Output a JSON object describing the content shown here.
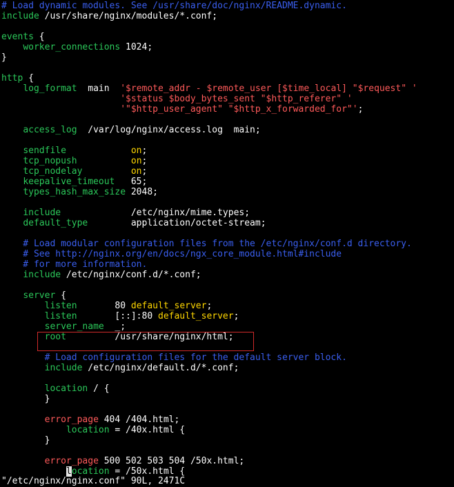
{
  "colors": {
    "background": "#000000",
    "text": "#ffffff",
    "comment": "#3a5ff0",
    "keyword": "#2bc85a",
    "string": "#ff5a5a",
    "value": "#ffd700",
    "highlight_box": "#d12a2a"
  },
  "lines": [
    [
      {
        "t": "# Load dynamic modules. See /usr/share/doc/nginx/README.dynamic.",
        "c": "comment"
      }
    ],
    [
      {
        "t": "include",
        "c": "keyword"
      },
      {
        "t": " /usr/share/nginx/modules/*.conf;",
        "c": "text"
      }
    ],
    [],
    [
      {
        "t": "events",
        "c": "keyword"
      },
      {
        "t": " {",
        "c": "text"
      }
    ],
    [
      {
        "t": "    ",
        "c": "text"
      },
      {
        "t": "worker_connections",
        "c": "keyword"
      },
      {
        "t": " 1024;",
        "c": "text"
      }
    ],
    [
      {
        "t": "}",
        "c": "text"
      }
    ],
    [],
    [
      {
        "t": "http",
        "c": "keyword"
      },
      {
        "t": " {",
        "c": "text"
      }
    ],
    [
      {
        "t": "    ",
        "c": "text"
      },
      {
        "t": "log_format",
        "c": "keyword"
      },
      {
        "t": "  main  ",
        "c": "text"
      },
      {
        "t": "'$remote_addr - $remote_user [$time_local] \"$request\" '",
        "c": "string"
      }
    ],
    [
      {
        "t": "                      ",
        "c": "text"
      },
      {
        "t": "'$status $body_bytes_sent \"$http_referer\" '",
        "c": "string"
      }
    ],
    [
      {
        "t": "                      ",
        "c": "text"
      },
      {
        "t": "'\"$http_user_agent\" \"$http_x_forwarded_for\"'",
        "c": "string"
      },
      {
        "t": ";",
        "c": "text"
      }
    ],
    [],
    [
      {
        "t": "    ",
        "c": "text"
      },
      {
        "t": "access_log",
        "c": "keyword"
      },
      {
        "t": "  /var/log/nginx/access.log  main;",
        "c": "text"
      }
    ],
    [],
    [
      {
        "t": "    ",
        "c": "text"
      },
      {
        "t": "sendfile",
        "c": "keyword"
      },
      {
        "t": "            ",
        "c": "text"
      },
      {
        "t": "on",
        "c": "value"
      },
      {
        "t": ";",
        "c": "text"
      }
    ],
    [
      {
        "t": "    ",
        "c": "text"
      },
      {
        "t": "tcp_nopush",
        "c": "keyword"
      },
      {
        "t": "          ",
        "c": "text"
      },
      {
        "t": "on",
        "c": "value"
      },
      {
        "t": ";",
        "c": "text"
      }
    ],
    [
      {
        "t": "    ",
        "c": "text"
      },
      {
        "t": "tcp_nodelay",
        "c": "keyword"
      },
      {
        "t": "         ",
        "c": "text"
      },
      {
        "t": "on",
        "c": "value"
      },
      {
        "t": ";",
        "c": "text"
      }
    ],
    [
      {
        "t": "    ",
        "c": "text"
      },
      {
        "t": "keepalive_timeout",
        "c": "keyword"
      },
      {
        "t": "   65;",
        "c": "text"
      }
    ],
    [
      {
        "t": "    ",
        "c": "text"
      },
      {
        "t": "types_hash_max_size",
        "c": "keyword"
      },
      {
        "t": " 2048;",
        "c": "text"
      }
    ],
    [],
    [
      {
        "t": "    ",
        "c": "text"
      },
      {
        "t": "include",
        "c": "keyword"
      },
      {
        "t": "             /etc/nginx/mime.types;",
        "c": "text"
      }
    ],
    [
      {
        "t": "    ",
        "c": "text"
      },
      {
        "t": "default_type",
        "c": "keyword"
      },
      {
        "t": "        application/octet-stream;",
        "c": "text"
      }
    ],
    [],
    [
      {
        "t": "    # Load modular configuration files from the /etc/nginx/conf.d directory.",
        "c": "comment"
      }
    ],
    [
      {
        "t": "    # See http://nginx.org/en/docs/ngx_core_module.html#include",
        "c": "comment"
      }
    ],
    [
      {
        "t": "    # for more information.",
        "c": "comment"
      }
    ],
    [
      {
        "t": "    ",
        "c": "text"
      },
      {
        "t": "include",
        "c": "keyword"
      },
      {
        "t": " /etc/nginx/conf.d/*.conf;",
        "c": "text"
      }
    ],
    [],
    [
      {
        "t": "    ",
        "c": "text"
      },
      {
        "t": "server",
        "c": "keyword"
      },
      {
        "t": " {",
        "c": "text"
      }
    ],
    [
      {
        "t": "        ",
        "c": "text"
      },
      {
        "t": "listen",
        "c": "keyword"
      },
      {
        "t": "       80 ",
        "c": "text"
      },
      {
        "t": "default_server",
        "c": "value"
      },
      {
        "t": ";",
        "c": "text"
      }
    ],
    [
      {
        "t": "        ",
        "c": "text"
      },
      {
        "t": "listen",
        "c": "keyword"
      },
      {
        "t": "       [::]:80 ",
        "c": "text"
      },
      {
        "t": "default_server",
        "c": "value"
      },
      {
        "t": ";",
        "c": "text"
      }
    ],
    [
      {
        "t": "        ",
        "c": "text"
      },
      {
        "t": "server_name",
        "c": "keyword"
      },
      {
        "t": "  _;",
        "c": "text"
      }
    ],
    [
      {
        "t": "        ",
        "c": "text"
      },
      {
        "t": "root",
        "c": "keyword"
      },
      {
        "t": "         /usr/share/nginx/html;",
        "c": "text"
      }
    ],
    [],
    [
      {
        "t": "        # Load configuration files for the default server block.",
        "c": "comment"
      }
    ],
    [
      {
        "t": "        ",
        "c": "text"
      },
      {
        "t": "include",
        "c": "keyword"
      },
      {
        "t": " /etc/nginx/default.d/*.conf;",
        "c": "text"
      }
    ],
    [],
    [
      {
        "t": "        ",
        "c": "text"
      },
      {
        "t": "location",
        "c": "keyword"
      },
      {
        "t": " / {",
        "c": "text"
      }
    ],
    [
      {
        "t": "        }",
        "c": "text"
      }
    ],
    [],
    [
      {
        "t": "        ",
        "c": "text"
      },
      {
        "t": "error_page",
        "c": "string"
      },
      {
        "t": " 404 /404.html;",
        "c": "text"
      }
    ],
    [
      {
        "t": "            ",
        "c": "text"
      },
      {
        "t": "location",
        "c": "keyword"
      },
      {
        "t": " = /40x.html {",
        "c": "text"
      }
    ],
    [
      {
        "t": "        }",
        "c": "text"
      }
    ],
    [],
    [
      {
        "t": "        ",
        "c": "text"
      },
      {
        "t": "error_page",
        "c": "string"
      },
      {
        "t": " 500 502 503 504 /50x.html;",
        "c": "text"
      }
    ],
    [
      {
        "t": "            ",
        "c": "text"
      },
      {
        "t": "l",
        "c": "cursor"
      },
      {
        "t": "ocation",
        "c": "keyword"
      },
      {
        "t": " = /50x.html {",
        "c": "text"
      }
    ]
  ],
  "status_line": "\"/etc/nginx/nginx.conf\" 90L, 2471C"
}
